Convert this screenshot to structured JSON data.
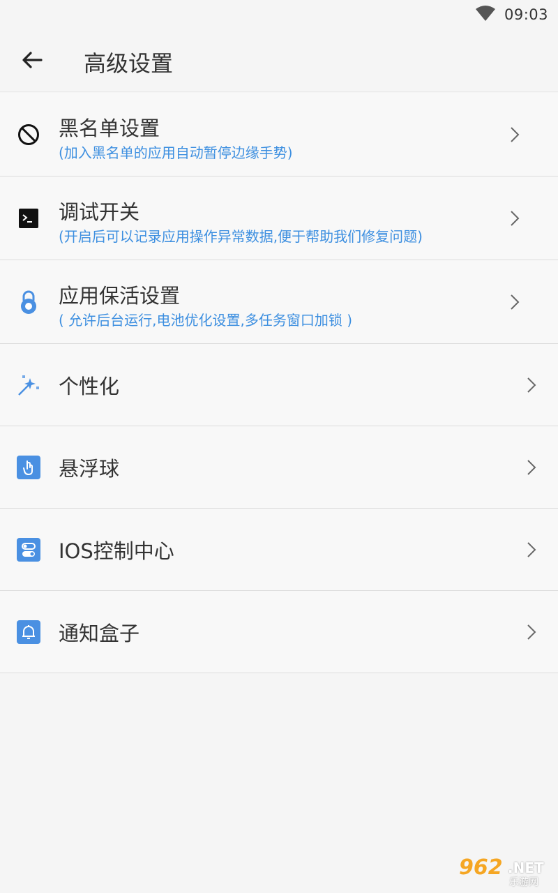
{
  "status_bar": {
    "time": "09:03",
    "wifi_icon": "wifi-icon"
  },
  "toolbar": {
    "title": "高级设置",
    "back_icon": "arrow-left-icon"
  },
  "items": [
    {
      "title": "黑名单设置",
      "subtitle": "(加入黑名单的应用自动暂停边缘手势)",
      "icon": "block-icon"
    },
    {
      "title": "调试开关",
      "subtitle": "(开启后可以记录应用操作异常数据,便于帮助我们修复问题)",
      "icon": "terminal-icon"
    },
    {
      "title": "应用保活设置",
      "subtitle": "( 允许后台运行,电池优化设置,多任务窗口加锁 )",
      "icon": "lock-icon"
    },
    {
      "title": "个性化",
      "icon": "magic-wand-icon"
    },
    {
      "title": "悬浮球",
      "icon": "touch-icon"
    },
    {
      "title": "IOS控制中心",
      "icon": "toggle-icon"
    },
    {
      "title": "通知盒子",
      "icon": "bell-icon"
    }
  ],
  "watermark": {
    "brand": "962",
    "tld": ".NET",
    "sub": "乐游网"
  },
  "colors": {
    "accent": "#3d8fe0",
    "icon_blue": "#4a90e2",
    "background": "#f5f5f5",
    "divider": "#dcdcdc"
  }
}
